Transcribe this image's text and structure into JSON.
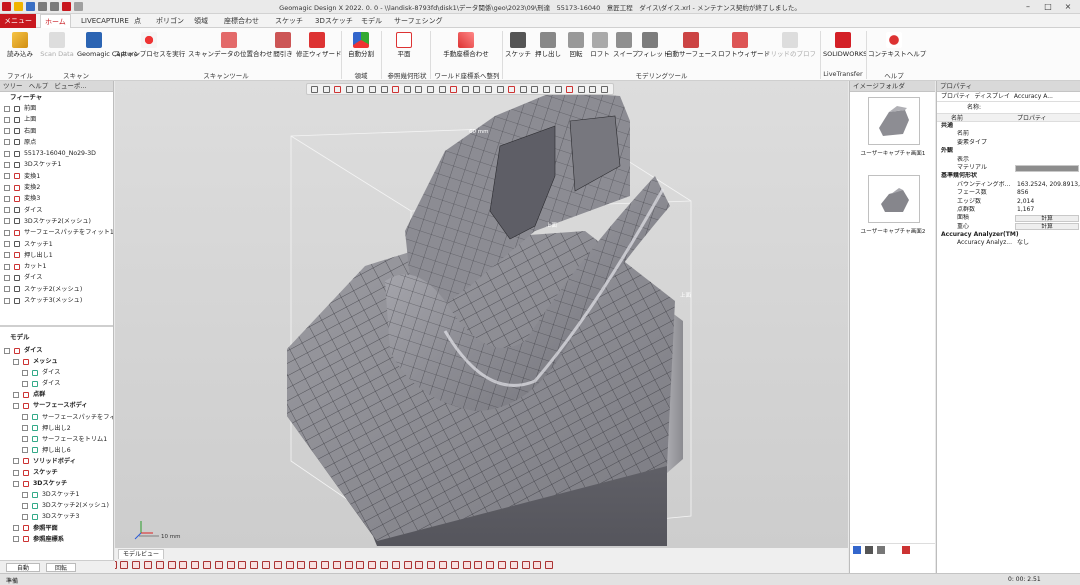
{
  "titlebar": {
    "title": "Geomagic Design X 2022. 0. 0 - \\\\landisk-8793fd\\disk1\\データ関係\\geo\\2023\\09\\刑達　55173-16040　意匠工程　ダイス\\ダイス.xrl - メンテナンス契約が終了しました。",
    "app_icon": "geomagic-logo-icon",
    "window_controls": [
      "–",
      "□",
      "×"
    ]
  },
  "menubar": {
    "menu_label": "メニュー",
    "tabs": [
      "ホーム",
      "LIVECAPTURE",
      "点",
      "ポリゴン",
      "領域",
      "座標合わせ",
      "スケッチ",
      "3Dスケッチ",
      "モデル",
      "サーフェシング"
    ],
    "active_tab": "ホーム"
  },
  "ribbon": {
    "buttons": [
      {
        "label": "読み込み",
        "icon": "import-icon"
      },
      {
        "label": "Scan Data",
        "icon": "scan-icon"
      },
      {
        "label": "Geomagic Capture",
        "icon": "capture-icon"
      },
      {
        "label": "スキャンプロセスを実行",
        "icon": "process-icon"
      },
      {
        "label": "スキャンデータの位置合わせ",
        "icon": "align-icon"
      },
      {
        "label": "間引き",
        "icon": "decimate-icon"
      },
      {
        "label": "修正ウィザード",
        "icon": "repair-icon"
      },
      {
        "label": "自動分割",
        "icon": "segment-icon"
      },
      {
        "label": "平面",
        "icon": "plane-icon"
      },
      {
        "label": "手動座標合わせ",
        "icon": "manual-align-icon"
      },
      {
        "label": "スケッチ",
        "icon": "sketch-icon"
      },
      {
        "label": "押し出し",
        "icon": "extrude-icon"
      },
      {
        "label": "回転",
        "icon": "revolve-icon"
      },
      {
        "label": "ロフト",
        "icon": "loft-icon"
      },
      {
        "label": "スイープ",
        "icon": "sweep-icon"
      },
      {
        "label": "フィレット",
        "icon": "fillet-icon"
      },
      {
        "label": "自動サーフェース",
        "icon": "autosurface-icon"
      },
      {
        "label": "ロフトウィザード",
        "icon": "loft-wizard-icon"
      },
      {
        "label": "ソリッドのプロファイル",
        "icon": "solid-profile-icon"
      },
      {
        "label": "SOLIDWORKS",
        "icon": "solidworks-icon"
      },
      {
        "label": "コンテキストヘルプ",
        "icon": "help-icon"
      }
    ],
    "groups": [
      "ファイル",
      "スキャン",
      "スキャンツール",
      "領域",
      "参照幾何形状",
      "ワールド座標系へ整列",
      "モデリングツール",
      "LiveTransfer",
      "ヘルプ"
    ]
  },
  "left_panel": {
    "tabs": [
      "ツリー",
      "ヘルプ",
      "ビューポ..."
    ],
    "feature_header": "フィーチャ",
    "feature_items": [
      {
        "label": "前面",
        "icon": "plane-icon"
      },
      {
        "label": "上面",
        "icon": "plane-icon"
      },
      {
        "label": "右面",
        "icon": "plane-icon"
      },
      {
        "label": "原点",
        "icon": "origin-icon"
      },
      {
        "label": "55173-16040_No29-3D",
        "icon": "mesh-icon"
      },
      {
        "label": "3Dスケッチ1",
        "icon": "sketch-icon"
      },
      {
        "label": "変換1",
        "icon": "transform-icon"
      },
      {
        "label": "変換2",
        "icon": "transform-icon"
      },
      {
        "label": "変換3",
        "icon": "transform-icon"
      },
      {
        "label": "ダイス",
        "icon": "die-icon"
      },
      {
        "label": "3Dスケッチ2(メッシュ)",
        "icon": "sketch-icon"
      },
      {
        "label": "サーフェースパッチをフィット1",
        "icon": "surface-icon"
      },
      {
        "label": "スケッチ1",
        "icon": "sketch-icon"
      },
      {
        "label": "押し出し1",
        "icon": "extrude-icon"
      },
      {
        "label": "カット1",
        "icon": "cut-icon"
      },
      {
        "label": "ダイス",
        "icon": "die-icon"
      },
      {
        "label": "スケッチ2(メッシュ)",
        "icon": "sketch-icon"
      },
      {
        "label": "スケッチ3(メッシュ)",
        "icon": "sketch-icon"
      }
    ],
    "model_header": "モデル",
    "model_items": [
      {
        "label": "ダイス",
        "indent": 0,
        "bold": true
      },
      {
        "label": "メッシュ",
        "indent": 1,
        "bold": true
      },
      {
        "label": "ダイス",
        "indent": 2,
        "bold": false
      },
      {
        "label": "ダイス",
        "indent": 2,
        "bold": false
      },
      {
        "label": "点群",
        "indent": 1,
        "bold": true
      },
      {
        "label": "サーフェースボディ",
        "indent": 1,
        "bold": true
      },
      {
        "label": "サーフェースパッチをフィ...",
        "indent": 2,
        "bold": false
      },
      {
        "label": "押し出し2",
        "indent": 2,
        "bold": false
      },
      {
        "label": "サーフェースをトリム1",
        "indent": 2,
        "bold": false
      },
      {
        "label": "押し出し6",
        "indent": 2,
        "bold": false
      },
      {
        "label": "ソリッドボディ",
        "indent": 1,
        "bold": true
      },
      {
        "label": "スケッチ",
        "indent": 1,
        "bold": true
      },
      {
        "label": "3Dスケッチ",
        "indent": 1,
        "bold": true
      },
      {
        "label": "3Dスケッチ1",
        "indent": 2,
        "bold": false
      },
      {
        "label": "3Dスケッチ2(メッシュ)",
        "indent": 2,
        "bold": false
      },
      {
        "label": "3Dスケッチ3",
        "indent": 2,
        "bold": false
      },
      {
        "label": "参照平面",
        "indent": 1,
        "bold": true
      },
      {
        "label": "参照座標系",
        "indent": 1,
        "bold": true
      }
    ]
  },
  "viewport": {
    "dim_label_top": "60 mm",
    "dim_label_mid": "上面",
    "dim_label_right": "上面",
    "scale_label": "10 mm",
    "tab_label": "モデルビュー"
  },
  "image_panel": {
    "header": "イメージフォルダ",
    "items": [
      "ユーザーキャプチャ画面1",
      "ユーザーキャプチャ画面2"
    ]
  },
  "property_panel": {
    "header": "プロパティ",
    "tabs": [
      "プロパティ",
      "ディスプレイ",
      "Accuracy A..."
    ],
    "name_label": "名称:",
    "col_name": "名前",
    "col_prop": "プロパティ",
    "rows": [
      {
        "name": "共通",
        "value": "",
        "type": "section"
      },
      {
        "name": "名前",
        "value": "",
        "type": "row"
      },
      {
        "name": "要素タイプ",
        "value": "",
        "type": "row"
      },
      {
        "name": "外観",
        "value": "",
        "type": "section"
      },
      {
        "name": "表示",
        "value": "",
        "type": "row"
      },
      {
        "name": "マテリアル",
        "value": "",
        "type": "material"
      },
      {
        "name": "基準幾何形状",
        "value": "",
        "type": "section"
      },
      {
        "name": "バウンディングボ...",
        "value": "163.2524, 209.8913, ...",
        "type": "row"
      },
      {
        "name": "フェース数",
        "value": "856",
        "type": "row"
      },
      {
        "name": "エッジ数",
        "value": "2,014",
        "type": "row"
      },
      {
        "name": "点群数",
        "value": "1,167",
        "type": "row"
      },
      {
        "name": "面積",
        "value": "計算",
        "type": "button"
      },
      {
        "name": "重心",
        "value": "計算",
        "type": "button"
      },
      {
        "name": "Accuracy Analyzer(TM)",
        "value": "",
        "type": "section"
      },
      {
        "name": "Accuracy Analyz...",
        "value": "なし",
        "type": "row"
      }
    ]
  },
  "bottom": {
    "left_buttons": [
      "自動",
      "回転"
    ],
    "status_left": "準備",
    "status_right": "0: 00: 2.51"
  },
  "colors": {
    "brand_red": "#c8171e",
    "model_gray": "#8a8a8e",
    "mesh_line": "#2b2b2f",
    "bbox": "#f0f0f0"
  }
}
